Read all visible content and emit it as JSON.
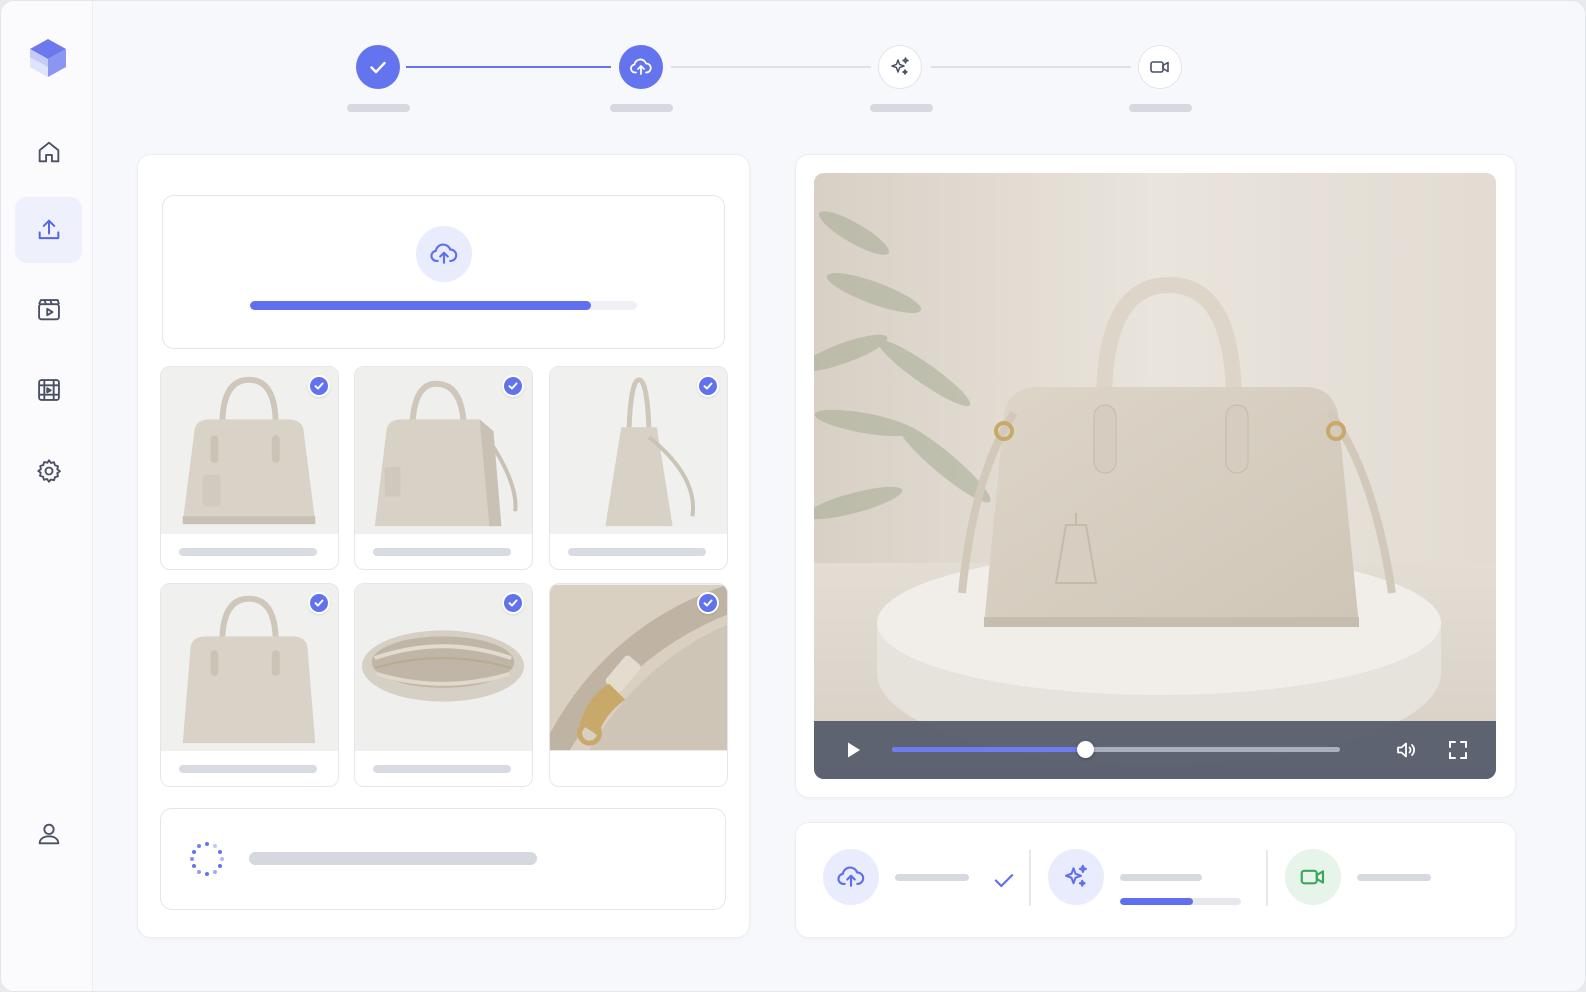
{
  "sidebar": {
    "logo_icon": "cube-logo",
    "items": [
      {
        "icon": "home-icon",
        "active": false
      },
      {
        "icon": "upload-icon",
        "active": true
      },
      {
        "icon": "video-library-icon",
        "active": false
      },
      {
        "icon": "film-grid-icon",
        "active": false
      },
      {
        "icon": "gear-icon",
        "active": false
      }
    ],
    "profile_icon": "user-icon"
  },
  "stepper": {
    "steps": [
      {
        "icon": "check-icon",
        "state": "done"
      },
      {
        "icon": "cloud-upload-icon",
        "state": "current"
      },
      {
        "icon": "sparkles-icon",
        "state": "todo"
      },
      {
        "icon": "video-camera-icon",
        "state": "todo"
      }
    ]
  },
  "upload": {
    "progress": 0.88,
    "images": [
      {
        "view": "front",
        "selected": true
      },
      {
        "view": "three-quarter",
        "selected": true
      },
      {
        "view": "side",
        "selected": true
      },
      {
        "view": "front-plain",
        "selected": true
      },
      {
        "view": "top-open",
        "selected": true
      },
      {
        "view": "hardware-detail",
        "selected": true
      }
    ],
    "status": "loading"
  },
  "player": {
    "progress": 0.43,
    "icons": [
      "play-icon",
      "volume-icon",
      "fullscreen-icon"
    ]
  },
  "pipeline": {
    "stages": [
      {
        "icon": "cloud-upload-icon",
        "state": "complete"
      },
      {
        "icon": "sparkles-icon",
        "state": "in-progress",
        "progress": 0.6
      },
      {
        "icon": "video-camera-icon",
        "state": "pending"
      }
    ]
  },
  "colors": {
    "accent": "#6272ec",
    "accent_light": "#e9ecfc",
    "success_bg": "#e6f4ea",
    "success": "#3aa55d",
    "placeholder": "#d7d9e0"
  }
}
